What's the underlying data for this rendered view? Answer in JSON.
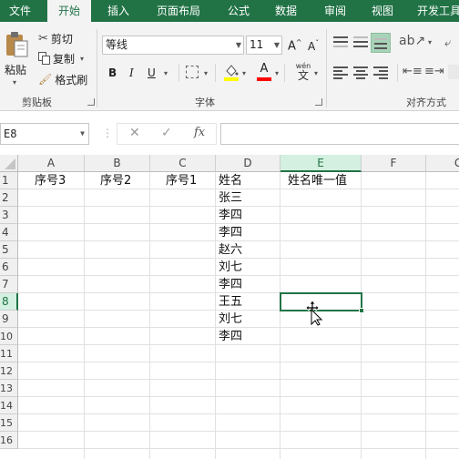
{
  "ribbon_tabs": [
    "文件",
    "开始",
    "插入",
    "页面布局",
    "公式",
    "数据",
    "审阅",
    "视图",
    "开发工具"
  ],
  "active_tab": "开始",
  "clipboard": {
    "paste_label": "粘贴",
    "cut_label": "剪切",
    "copy_label": "复制",
    "format_painter_label": "格式刷",
    "group_label": "剪贴板"
  },
  "font": {
    "font_name": "等线",
    "font_size": "11",
    "bold": "B",
    "italic": "I",
    "underline": "U",
    "phonetic_top": "wén",
    "phonetic_bottom": "文",
    "group_label": "字体",
    "fill_color": "#ffff00",
    "font_color": "#ff0000"
  },
  "alignment": {
    "group_label": "对齐方式"
  },
  "formula_bar": {
    "name_box": "E8",
    "cancel_icon": "✕",
    "enter_icon": "✓",
    "fx_label": "fx",
    "formula": ""
  },
  "sheet": {
    "columns": [
      "A",
      "B",
      "C",
      "D",
      "E",
      "F",
      "G"
    ],
    "selected_column": "E",
    "rows": [
      "1",
      "2",
      "3",
      "4",
      "5",
      "6",
      "7",
      "8",
      "9",
      "10",
      "11",
      "12",
      "13",
      "14",
      "15",
      "16"
    ],
    "selected_row": "8",
    "cells": {
      "A1": "序号3",
      "B1": "序号2",
      "C1": "序号1",
      "D1": "姓名",
      "E1": "姓名唯一值",
      "D2": "张三",
      "D3": "李四",
      "D4": "李四",
      "D5": "赵六",
      "D6": "刘七",
      "D7": "李四",
      "D8": "王五",
      "D9": "刘七",
      "D10": "李四"
    },
    "selected_cell": "E8"
  },
  "colors": {
    "accent": "#217346",
    "ribbon_bg": "#f3f3f3"
  }
}
